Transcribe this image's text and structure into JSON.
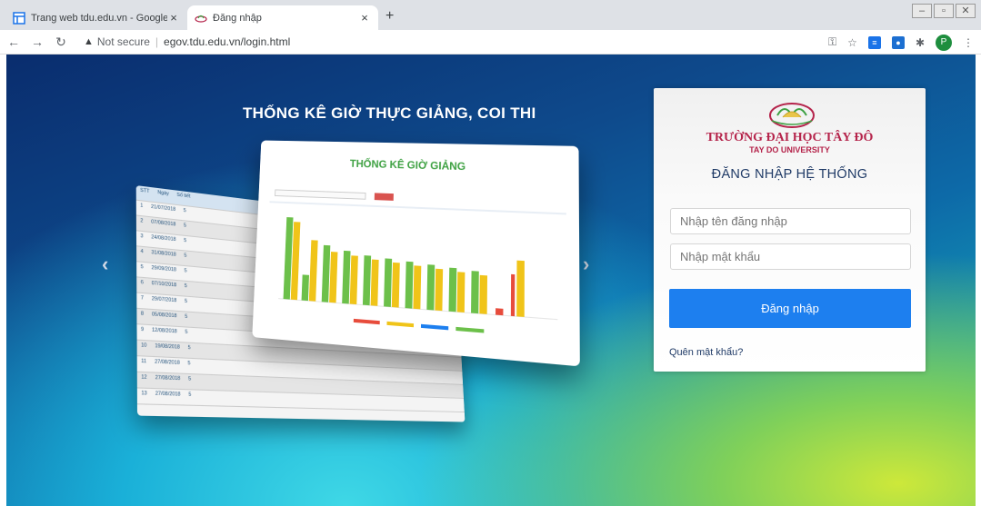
{
  "browser": {
    "tabs": [
      {
        "title": "Trang web tdu.edu.vn - Google S",
        "active": false
      },
      {
        "title": "Đăng nhập",
        "active": true
      }
    ],
    "new_tab": "+",
    "tab_close": "×",
    "url_warning": "Not secure",
    "url": "egov.tdu.edu.vn/login.html",
    "profile_initial": "P"
  },
  "slide": {
    "title": "THỐNG KÊ GIỜ THỰC GIẢNG, COI THI",
    "mock_title": "THỐNG KÊ GIỜ GIẢNG"
  },
  "login": {
    "university_name": "TRƯỜNG ĐẠI HỌC TÂY ĐÔ",
    "university_sub": "TAY DO UNIVERSITY",
    "system_title": "ĐĂNG NHẬP HỆ THỐNG",
    "username_placeholder": "Nhập tên đăng nhập",
    "password_placeholder": "Nhập mật khẩu",
    "submit_label": "Đăng nhập",
    "forgot_label": "Quên mật khẩu?"
  },
  "colors": {
    "brand": "#b5244b",
    "button": "#1d7fef",
    "bar_yellow": "#f0c419",
    "bar_green": "#6cc04a",
    "bar_red": "#e74c3c"
  }
}
